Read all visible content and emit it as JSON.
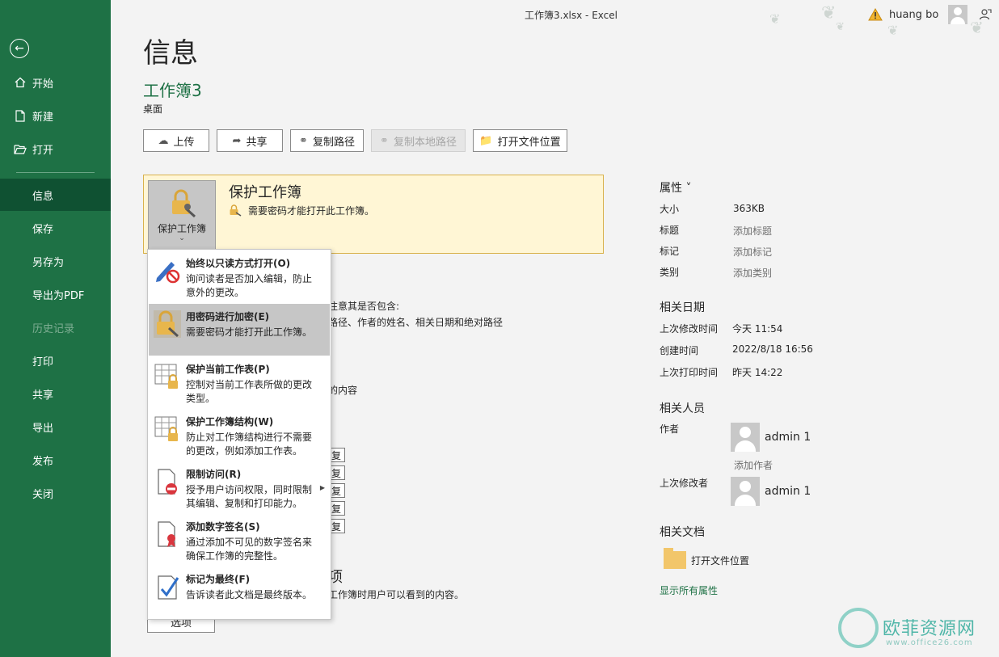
{
  "window": {
    "title": "工作簿3.xlsx  -  Excel",
    "user": "huang bo"
  },
  "sidebar": {
    "items": [
      {
        "label": "开始",
        "icon": "home-icon"
      },
      {
        "label": "新建",
        "icon": "new-file-icon"
      },
      {
        "label": "打开",
        "icon": "open-folder-icon"
      },
      {
        "label": "信息",
        "active": true
      },
      {
        "label": "保存"
      },
      {
        "label": "另存为"
      },
      {
        "label": "导出为PDF"
      },
      {
        "label": "历史记录",
        "disabled": true
      },
      {
        "label": "打印"
      },
      {
        "label": "共享"
      },
      {
        "label": "导出"
      },
      {
        "label": "发布"
      },
      {
        "label": "关闭"
      }
    ]
  },
  "main": {
    "title": "信息",
    "doc_name": "工作簿3",
    "doc_location": "桌面",
    "buttons": {
      "upload": "上传",
      "share": "共享",
      "copy_path": "复制路径",
      "copy_local_path": "复制本地路径",
      "open_location": "打开文件位置"
    },
    "protect": {
      "tile_label": "保护工作簿",
      "heading": "保护工作簿",
      "desc": "需要密码才能打开此工作簿。"
    },
    "bg_text": {
      "line1": "注意其是否包含:",
      "line2": "路径、作者的姓名、相关日期和绝对路径",
      "line3": "的内容",
      "heading": "项",
      "line4": "工作簿时用户可以看到的内容。",
      "small_btn": "复"
    },
    "options_label": "选项"
  },
  "menu": {
    "items": [
      {
        "title": "始终以只读方式打开(O)",
        "desc": "询问读者是否加入编辑，防止意外的更改。"
      },
      {
        "title": "用密码进行加密(E)",
        "desc": "需要密码才能打开此工作簿。"
      },
      {
        "title": "保护当前工作表(P)",
        "desc": "控制对当前工作表所做的更改类型。"
      },
      {
        "title": "保护工作簿结构(W)",
        "desc": "防止对工作簿结构进行不需要的更改，例如添加工作表。"
      },
      {
        "title": "限制访问(R)",
        "desc": "授予用户访问权限，同时限制其编辑、复制和打印能力。"
      },
      {
        "title": "添加数字签名(S)",
        "desc": "通过添加不可见的数字签名来确保工作簿的完整性。"
      },
      {
        "title": "标记为最终(F)",
        "desc": "告诉读者此文档是最终版本。"
      }
    ]
  },
  "properties": {
    "heading": "属性 ˅",
    "rows": [
      {
        "label": "大小",
        "value": "363KB"
      },
      {
        "label": "标题",
        "value": "添加标题"
      },
      {
        "label": "标记",
        "value": "添加标记"
      },
      {
        "label": "类别",
        "value": "添加类别"
      }
    ],
    "dates_heading": "相关日期",
    "dates": [
      {
        "label": "上次修改时间",
        "value": "今天 11:54"
      },
      {
        "label": "创建时间",
        "value": "2022/8/18 16:56"
      },
      {
        "label": "上次打印时间",
        "value": "昨天 14:22"
      }
    ],
    "people_heading": "相关人员",
    "author_label": "作者",
    "author_name": "admin 1",
    "add_author": "添加作者",
    "modifier_label": "上次修改者",
    "modifier_name": "admin 1",
    "docs_heading": "相关文档",
    "open_location": "打开文件位置",
    "show_all": "显示所有属性"
  },
  "watermark": {
    "name": "欧菲资源网",
    "url": "www.office26.com"
  }
}
